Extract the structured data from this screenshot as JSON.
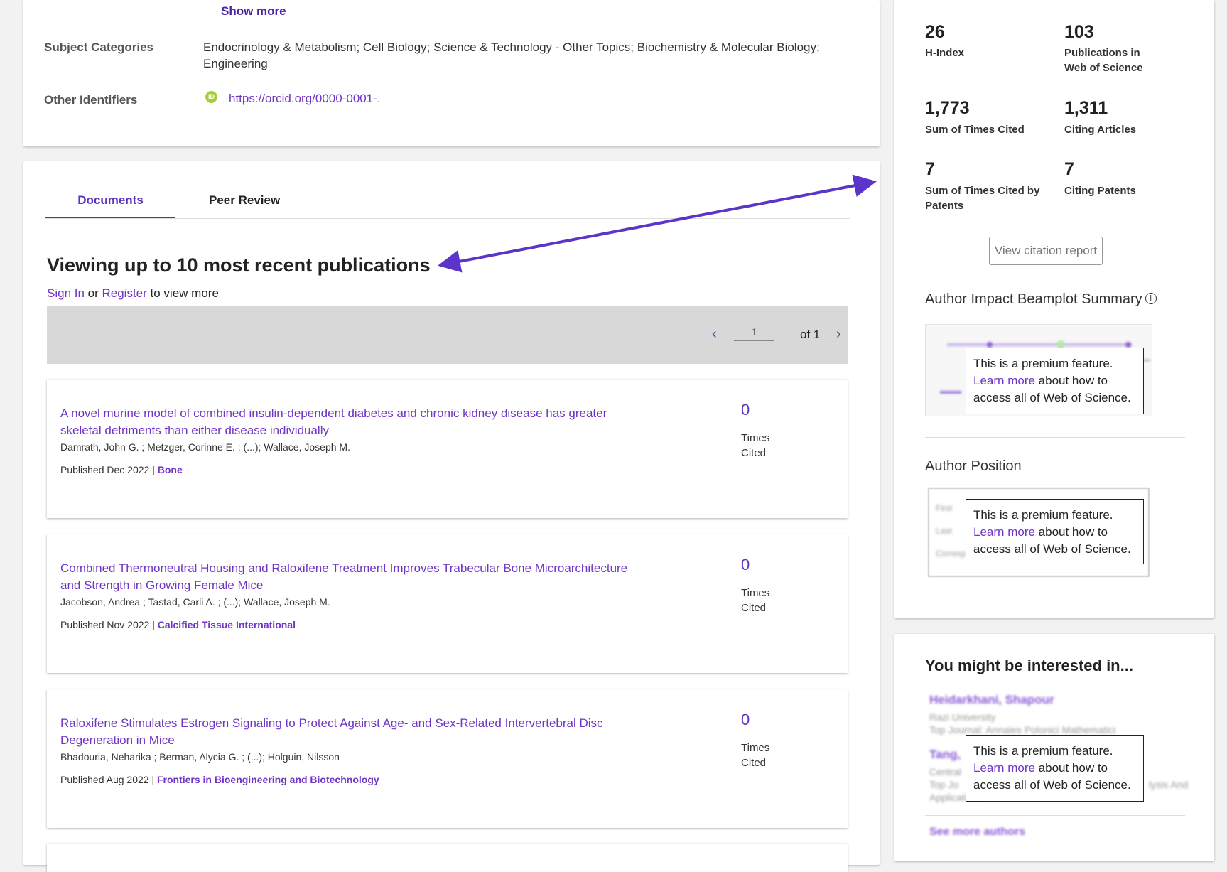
{
  "profile": {
    "show_more": "Show more",
    "subject_label": "Subject Categories",
    "subject_value": "Endocrinology & Metabolism;  Cell Biology;  Science & Technology - Other Topics;  Biochemistry & Molecular Biology;  Engineering",
    "identifiers_label": "Other Identifiers",
    "orcid_icon_text": "iD",
    "orcid_link": "https://orcid.org/0000-0001-."
  },
  "tabs": {
    "documents": "Documents",
    "peer_review": "Peer Review"
  },
  "documents": {
    "heading": "Viewing up to 10 most recent publications",
    "signin": "Sign In",
    "or": " or ",
    "register": "Register",
    "view_more": " to view more",
    "pager": {
      "prev": "‹",
      "page": "1",
      "of": "of 1",
      "next": "›"
    },
    "items": [
      {
        "title": "A novel murine model of combined insulin-dependent diabetes and chronic kidney disease has greater skeletal detriments than either disease individually",
        "authors": "Damrath, John G. ; Metzger, Corinne E. ; (...); Wallace, Joseph M.",
        "published": "Published Dec 2022 | ",
        "journal": "Bone",
        "cited": "0",
        "cited_label": "Times Cited"
      },
      {
        "title": "Combined Thermoneutral Housing and Raloxifene Treatment Improves Trabecular Bone Microarchitecture and Strength in Growing Female Mice",
        "authors": "Jacobson, Andrea ; Tastad, Carli A. ; (...); Wallace, Joseph M.",
        "published": "Published Nov 2022 | ",
        "journal": "Calcified Tissue International",
        "cited": "0",
        "cited_label": "Times Cited"
      },
      {
        "title": "Raloxifene Stimulates Estrogen Signaling to Protect Against Age- and Sex-Related Intervertebral Disc Degeneration in Mice",
        "authors": "Bhadouria, Neharika ; Berman, Alycia G. ; (...); Holguin, Nilsson",
        "published": "Published Aug 2022 | ",
        "journal": "Frontiers in Bioengineering and Biotechnology",
        "cited": "0",
        "cited_label": "Times Cited"
      }
    ]
  },
  "metrics": {
    "h_index": {
      "value": "26",
      "label": "H-Index"
    },
    "publications": {
      "value": "103",
      "label": "Publications in Web of Science"
    },
    "times_cited": {
      "value": "1,773",
      "label": "Sum of Times Cited"
    },
    "citing_articles": {
      "value": "1,311",
      "label": "Citing Articles"
    },
    "cited_by_patents": {
      "value": "7",
      "label": "Sum of Times Cited by Patents"
    },
    "citing_patents": {
      "value": "7",
      "label": "Citing Patents"
    },
    "citation_report_button": "View citation report",
    "beamplot_title": "Author Impact Beamplot Summary",
    "info_icon": "i",
    "position_title": "Author Position",
    "position_blur_labels": [
      "First",
      "Last",
      "Corresp"
    ]
  },
  "premium": {
    "line1": "This is a premium feature.",
    "learn_more": "Learn more",
    "line2_rest": " about how to",
    "line3": "access all of Web of Science."
  },
  "interest": {
    "title": "You might be interested in...",
    "blurred": {
      "author1": "Heidarkhani, Shapour",
      "author1_inst": "Razi University",
      "author1_journal": "Top Journal: Annales Polonici Mathematici",
      "author2": "Tang,",
      "author2_inst": "Central",
      "author2_journal_start": "Top Jo",
      "author2_journal_end": "lysis And",
      "author2_journal_line2": "Applications",
      "see_more": "See more authors"
    }
  },
  "colors": {
    "accent": "#5e33bf",
    "link": "#6f35c4",
    "arrow": "#5b35c9"
  }
}
